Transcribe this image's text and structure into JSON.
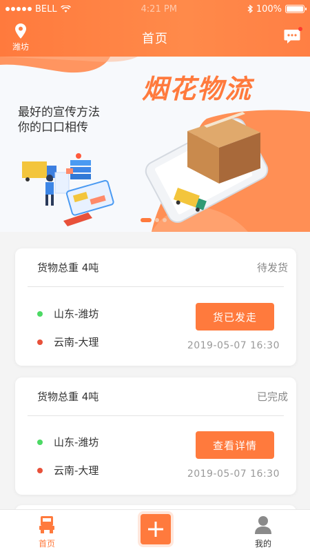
{
  "status_bar": {
    "carrier": "BELL",
    "time": "4:21 PM",
    "battery": "100%"
  },
  "nav": {
    "title": "首页",
    "location": "潍坊"
  },
  "banner": {
    "title": "烟花物流",
    "slogan_line1": "最好的宣传方法",
    "slogan_line2": "你的口口相传",
    "active_slide": 1,
    "slide_count": 3
  },
  "orders": [
    {
      "weight": "货物总重  4吨",
      "status": "待发货",
      "origin": "山东-潍坊",
      "destination": "云南-大理",
      "action": "货已发走",
      "time": "2019-05-07 16:30"
    },
    {
      "weight": "货物总重  4吨",
      "status": "已完成",
      "origin": "山东-潍坊",
      "destination": "云南-大理",
      "action": "查看详情",
      "time": "2019-05-07 16:30"
    }
  ],
  "tabbar": {
    "home": "首页",
    "mine": "我的"
  },
  "colors": {
    "accent": "#ff7a3d",
    "origin_dot": "#4cd964",
    "destination_dot": "#e8513a"
  }
}
